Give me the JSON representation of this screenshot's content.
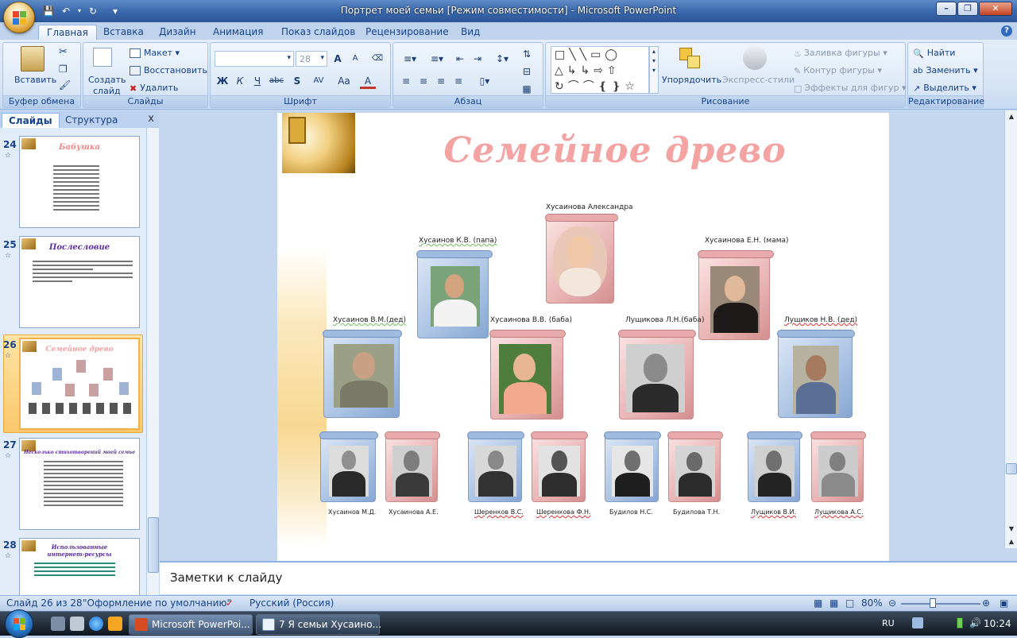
{
  "window": {
    "title": "Портрет моей семьи [Режим совместимости] - Microsoft PowerPoint"
  },
  "ribbon": {
    "tabs": [
      "Главная",
      "Вставка",
      "Дизайн",
      "Анимация",
      "Показ слайдов",
      "Рецензирование",
      "Вид"
    ],
    "active_tab": "Главная",
    "clipboard": {
      "paste": "Вставить",
      "label": "Буфер обмена"
    },
    "slides": {
      "new_slide_1": "Создать",
      "new_slide_2": "слайд",
      "layout": "Макет",
      "reset": "Восстановить",
      "delete": "Удалить",
      "label": "Слайды"
    },
    "font": {
      "size": "28",
      "label": "Шрифт",
      "bold": "Ж",
      "italic": "К",
      "underline": "Ч",
      "strike": "abc",
      "shadow": "S",
      "spacing": "AV",
      "case": "Aa",
      "color": "A",
      "grow": "A",
      "shrink": "A"
    },
    "paragraph": {
      "label": "Абзац"
    },
    "drawing": {
      "arrange": "Упорядочить",
      "quick_styles": "Экспресс-стили",
      "fill": "Заливка фигуры",
      "outline": "Контур фигуры",
      "effects": "Эффекты для фигур",
      "label": "Рисование"
    },
    "editing": {
      "find": "Найти",
      "replace": "Заменить",
      "select": "Выделить",
      "label": "Редактирование"
    }
  },
  "left_pane": {
    "tabs": [
      "Слайды",
      "Структура"
    ],
    "close": "x",
    "thumbnails": [
      {
        "num": "24",
        "title": "Бабушка"
      },
      {
        "num": "25",
        "title": "Послесловие"
      },
      {
        "num": "26",
        "title": "Семейное древо",
        "selected": true
      },
      {
        "num": "27",
        "title": "Несколько стихотворений моей семье"
      },
      {
        "num": "28",
        "title": "Использованные интернет-ресурсы"
      }
    ]
  },
  "slide": {
    "title": "Семейное древо",
    "people": {
      "child": "Хусаинова Александра",
      "father": "Хусаинов К.В. (папа)",
      "mother": "Хусаинова Е.Н. (мама)",
      "grandpa_f": "Хусаинов В.М.(дед)",
      "grandma_f": "Хусаинова В.В. (баба)",
      "grandma_m": "Лущикова Л.Н.(баба)",
      "grandpa_m": "Лущиков Н.В. (дед)",
      "g1": "Хусаинов М.Д.",
      "g2": "Хусаинова А.Е.",
      "g3": "Шеренков В.С.",
      "g4": "Шеренкова Ф.Н.",
      "g5": "Будилов Н.С.",
      "g6": "Будилова Т.Н.",
      "g7": "Лущиков В.И.",
      "g8": "Лущикова А.С."
    }
  },
  "notes": {
    "placeholder": "Заметки к слайду"
  },
  "status": {
    "slide_info": "Слайд 26 из 28",
    "theme": "\"Оформление по умолчанию\"",
    "language": "Русский (Россия)",
    "zoom": "80%"
  },
  "taskbar": {
    "tasks": [
      "Microsoft PowerPoi...",
      "7 Я семьи Хусаино..."
    ],
    "lang": "RU",
    "time": "10:24"
  },
  "colors": {
    "title_pink": "#f4a3a3",
    "ribbon_blue": "#15428b"
  }
}
